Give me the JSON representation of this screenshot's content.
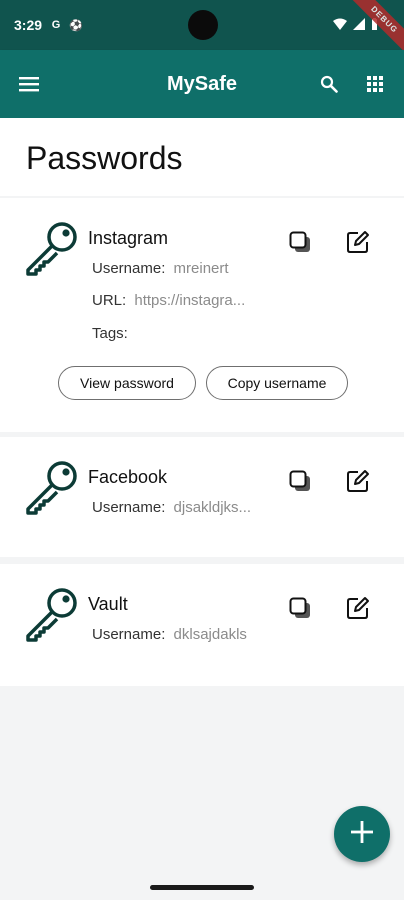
{
  "status_bar": {
    "time": "3:29",
    "left_glyphs": [
      "G",
      "⚽"
    ],
    "debug_label": "DEBUG"
  },
  "app_bar": {
    "title": "MySafe",
    "menu_icon": "menu-icon",
    "search_icon": "search-icon",
    "grid_icon": "grid-icon",
    "color": "#0f6f69"
  },
  "page": {
    "title": "Passwords"
  },
  "passwords": [
    {
      "name": "Instagram",
      "username_label": "Username:",
      "username": "mreinert",
      "url_label": "URL:",
      "url": "https://instagra...",
      "tags_label": "Tags:",
      "tags": "",
      "view_password_label": "View password",
      "copy_username_label": "Copy username"
    },
    {
      "name": "Facebook",
      "username_label": "Username:",
      "username": "djsakldjks..."
    },
    {
      "name": "Vault",
      "username_label": "Username:",
      "username": "dklsajdakls"
    }
  ],
  "fab": {
    "icon": "plus-icon"
  }
}
